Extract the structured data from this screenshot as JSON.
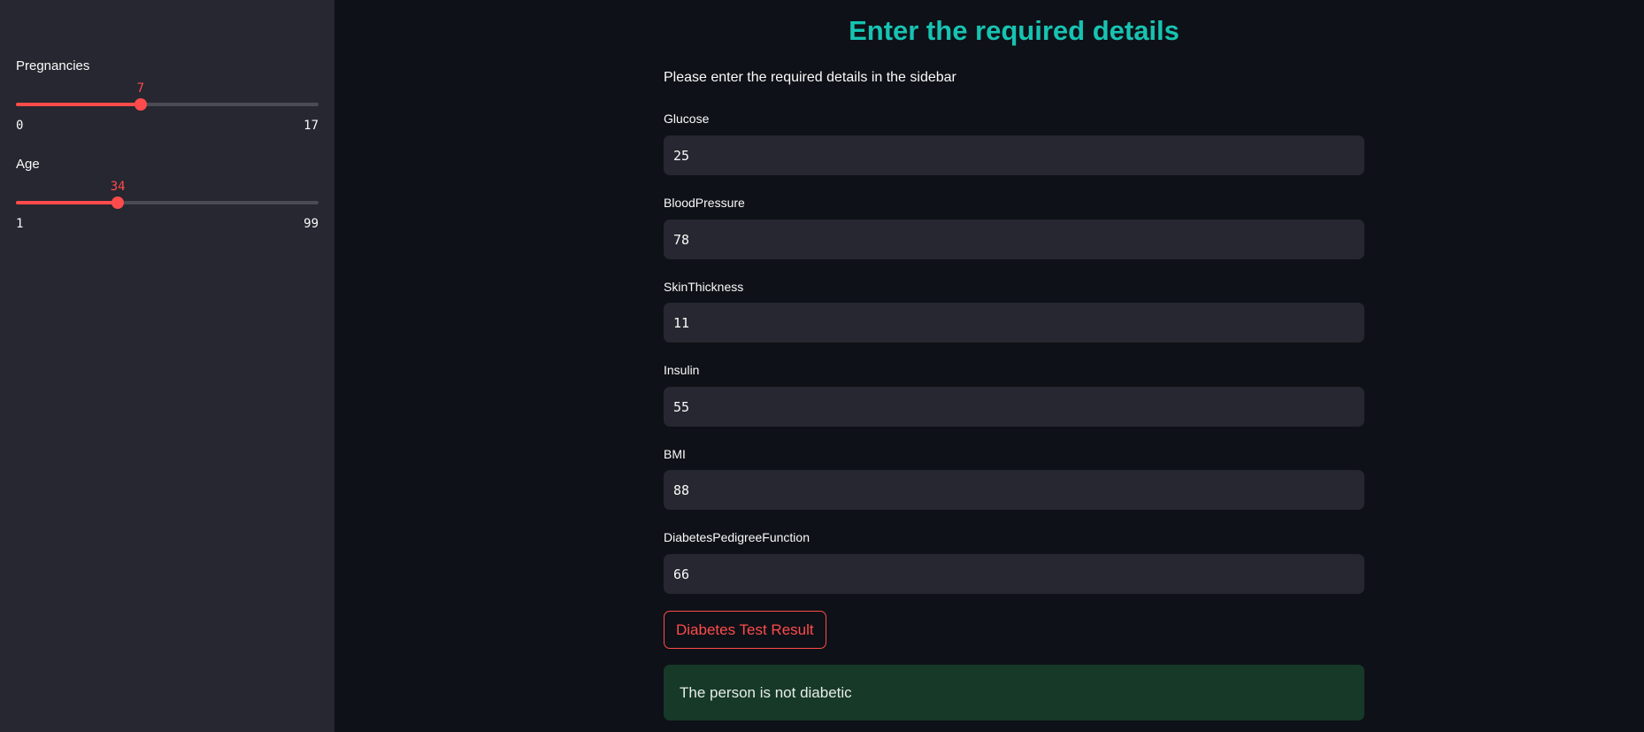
{
  "sidebar": {
    "sliders": [
      {
        "label": "Pregnancies",
        "value": 7,
        "min": 0,
        "max": 17,
        "value_text": "7",
        "min_text": "0",
        "max_text": "17"
      },
      {
        "label": "Age",
        "value": 34,
        "min": 1,
        "max": 99,
        "value_text": "34",
        "min_text": "1",
        "max_text": "99"
      }
    ]
  },
  "main": {
    "title": "Enter the required details",
    "description": "Please enter the required details in the sidebar",
    "fields": [
      {
        "label": "Glucose",
        "value": "25"
      },
      {
        "label": "BloodPressure",
        "value": "78"
      },
      {
        "label": "SkinThickness",
        "value": "11"
      },
      {
        "label": "Insulin",
        "value": "55"
      },
      {
        "label": "BMI",
        "value": "88"
      },
      {
        "label": "DiabetesPedigreeFunction",
        "value": "66"
      }
    ],
    "button_label": "Diabetes Test Result",
    "result_text": "The person is not diabetic"
  },
  "colors": {
    "accent": "#ff4b4b",
    "title": "#17c3b2",
    "sidebar_bg": "#262730",
    "page_bg": "#0e1117",
    "success_bg": "#173928"
  }
}
